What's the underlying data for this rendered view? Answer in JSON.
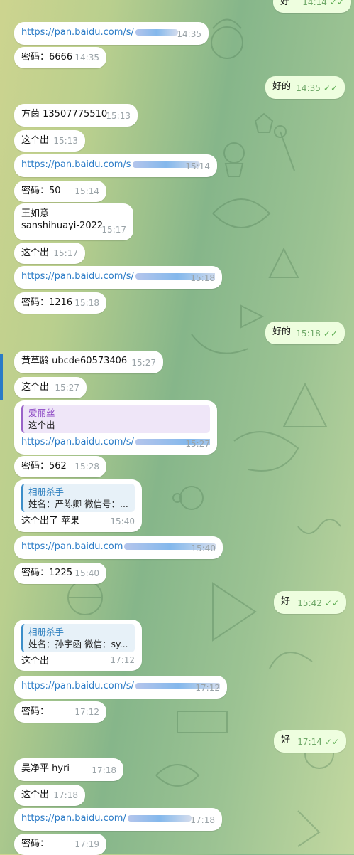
{
  "messages": [
    {
      "id": "m0",
      "dir": "out",
      "text": "好",
      "time": "14:14",
      "read": true
    },
    {
      "id": "m1",
      "dir": "in",
      "text": "https://pan.baidu.com/s/",
      "link": true,
      "blur": true,
      "time": "14:35"
    },
    {
      "id": "m2",
      "dir": "in",
      "text": "密码：6666",
      "time": "14:35"
    },
    {
      "id": "m3",
      "dir": "out",
      "text": "好的",
      "time": "14:35",
      "read": true
    },
    {
      "id": "m4",
      "dir": "in",
      "text": "方茵 13507775510",
      "time": "15:13"
    },
    {
      "id": "m5",
      "dir": "in",
      "text": "这个出",
      "time": "15:13"
    },
    {
      "id": "m6",
      "dir": "in",
      "text": "https://pan.baidu.com/s",
      "link": true,
      "blur": true,
      "time": "15:14"
    },
    {
      "id": "m7",
      "dir": "in",
      "text": "密码：50",
      "time": "15:14"
    },
    {
      "id": "m8",
      "dir": "in",
      "text": "王如意",
      "text2": "sanshihuayi-2022",
      "time": "15:17"
    },
    {
      "id": "m9",
      "dir": "in",
      "text": "这个出",
      "time": "15:17"
    },
    {
      "id": "m10",
      "dir": "in",
      "text": "https://pan.baidu.com/s/",
      "link": true,
      "blur": true,
      "time": "15:18"
    },
    {
      "id": "m11",
      "dir": "in",
      "text": "密码：1216",
      "time": "15:18"
    },
    {
      "id": "m12",
      "dir": "out",
      "text": "好的",
      "time": "15:18",
      "read": true
    },
    {
      "id": "m13",
      "dir": "in",
      "text": "黄草龄 ubcde60573406",
      "time": "15:27"
    },
    {
      "id": "m14",
      "dir": "in",
      "text": "这个出",
      "time": "15:27"
    },
    {
      "id": "m15",
      "dir": "in",
      "quote_title": "爱丽丝",
      "quote_body": "这个出",
      "text": "https://pan.baidu.com/s/",
      "link": true,
      "blur": true,
      "time": "15:27"
    },
    {
      "id": "m16",
      "dir": "in",
      "text": "密码：562",
      "time": "15:28"
    },
    {
      "id": "m17",
      "dir": "in",
      "quote_title": "相册杀手",
      "quote_body": "姓名：严陈卿 微信号：...",
      "text": "这个出了 苹果",
      "time": "15:40"
    },
    {
      "id": "m18",
      "dir": "in",
      "text": "https://pan.baidu.com",
      "link": true,
      "blur": true,
      "time": "15:40"
    },
    {
      "id": "m19",
      "dir": "in",
      "text": "密码：1225",
      "time": "15:40"
    },
    {
      "id": "m20",
      "dir": "out",
      "text": "好",
      "time": "15:42",
      "read": true
    },
    {
      "id": "m21",
      "dir": "in",
      "quote_title": "相册杀手",
      "quote_body": "姓名：孙宇函 微信：sy...",
      "text": "这个出",
      "time": "17:12"
    },
    {
      "id": "m22",
      "dir": "in",
      "text": "https://pan.baidu.com/s/",
      "link": true,
      "blur": true,
      "time": "17:12"
    },
    {
      "id": "m23",
      "dir": "in",
      "text": "密码：",
      "time": "17:12"
    },
    {
      "id": "m24",
      "dir": "out",
      "text": "好",
      "time": "17:14",
      "read": true
    },
    {
      "id": "m25",
      "dir": "in",
      "text": "吴净平 hyri",
      "time": "17:18"
    },
    {
      "id": "m26",
      "dir": "in",
      "text": "这个出",
      "time": "17:18"
    },
    {
      "id": "m27",
      "dir": "in",
      "text": "https://pan.baidu.com/",
      "link": true,
      "blur": true,
      "time": "17:18"
    },
    {
      "id": "m28",
      "dir": "in",
      "text": "密码：",
      "time": "17:19"
    }
  ],
  "colors": {
    "incoming": "#ffffff",
    "outgoing": "#eefedf",
    "link": "#2a7bc7",
    "read_ticks": "#5fae54"
  }
}
